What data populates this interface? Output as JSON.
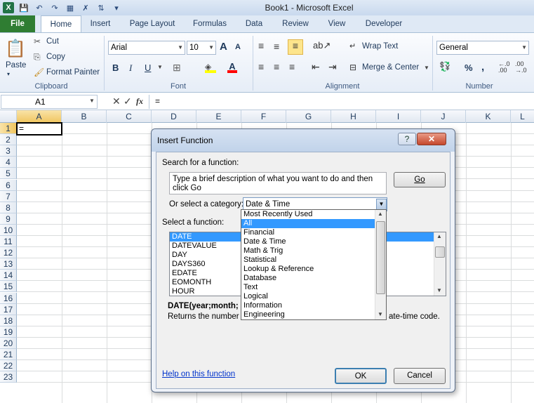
{
  "window": {
    "title": "Book1 - Microsoft Excel"
  },
  "tabs": [
    "File",
    "Home",
    "Insert",
    "Page Layout",
    "Formulas",
    "Data",
    "Review",
    "View",
    "Developer"
  ],
  "ribbon": {
    "clipboard": {
      "label": "Clipboard",
      "paste": "Paste",
      "cut": "Cut",
      "copy": "Copy",
      "format_painter": "Format Painter"
    },
    "font": {
      "label": "Font",
      "font_name": "Arial",
      "font_size": "10",
      "bold": "B",
      "italic": "I",
      "underline": "U",
      "grow": "A",
      "shrink": "A"
    },
    "alignment": {
      "label": "Alignment",
      "wrap_text": "Wrap Text",
      "merge_center": "Merge & Center"
    },
    "number": {
      "label": "Number",
      "format": "General",
      "percent": "%",
      "comma": ","
    }
  },
  "formula_bar": {
    "name_box": "A1",
    "fx": "fx",
    "content": "="
  },
  "sheet": {
    "columns": [
      "A",
      "B",
      "C",
      "D",
      "E",
      "F",
      "G",
      "H",
      "I",
      "J",
      "K",
      "L"
    ],
    "rows": [
      "1",
      "2",
      "3",
      "4",
      "5",
      "6",
      "7",
      "8",
      "9",
      "10",
      "11",
      "12",
      "13",
      "14",
      "15",
      "16",
      "17",
      "18",
      "19",
      "20",
      "21",
      "22",
      "23"
    ],
    "a1_value": "="
  },
  "dialog": {
    "title": "Insert Function",
    "search_label": "Search for a function:",
    "search_text": "Type a brief description of what you want to do and then click Go",
    "go_button": "Go",
    "category_label": "Or select a category:",
    "category_value": "Date & Time",
    "function_label": "Select a function:",
    "functions": [
      "DATE",
      "DATEVALUE",
      "DAY",
      "DAYS360",
      "EDATE",
      "EOMONTH",
      "HOUR"
    ],
    "selected_function": "DATE",
    "signature": "DATE(year;month;",
    "description_start": "Returns the number th",
    "description_end": "ate-time code.",
    "help_link": "Help on this function",
    "ok_button": "OK",
    "cancel_button": "Cancel",
    "help_button": "?",
    "close_button": "✕",
    "category_options": [
      "Most Recently Used",
      "All",
      "Financial",
      "Date & Time",
      "Math & Trig",
      "Statistical",
      "Lookup & Reference",
      "Database",
      "Text",
      "Logical",
      "Information",
      "Engineering"
    ],
    "highlighted_category": "All"
  },
  "colors": {
    "file_tab": "#2f7d32",
    "selection": "#3399ff",
    "close_button": "#c5472c"
  }
}
